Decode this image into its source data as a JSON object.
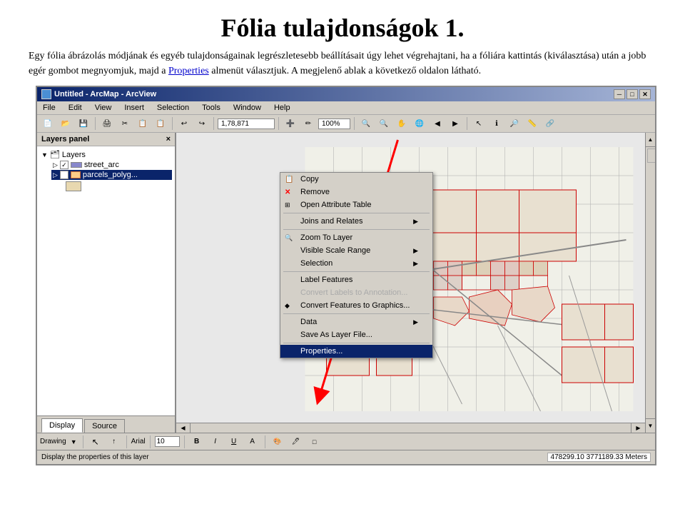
{
  "page": {
    "title": "Fólia tulajdonságok 1.",
    "description_part1": "Egy fólia ábrázolás módjának és egyéb tulajdonságainak legrészletesebb beállításait úgy lehet végrehajtani, ha a fóliára kattintás (kiválasztása) után a jobb egér gombot megnyomjuk, majd a ",
    "description_link": "Properties",
    "description_part2": " almenüt választjuk. A megjelenő ablak a következő oldalon látható."
  },
  "window": {
    "title": "Untitled - ArcMap - ArcView",
    "minimize": "─",
    "maximize": "□",
    "close": "✕"
  },
  "menubar": {
    "items": [
      "File",
      "Edit",
      "View",
      "Insert",
      "Selection",
      "Tools",
      "Window",
      "Help"
    ]
  },
  "toolbar": {
    "coord_display": "1,78,871",
    "zoom_level": "100%",
    "font_name": "Arial",
    "font_size": "10"
  },
  "toc": {
    "header": "×",
    "layers_label": "Layers",
    "layer1": {
      "name": "street_arc",
      "checked": true
    },
    "layer2": {
      "name": "parcels_polyg...",
      "checked": true,
      "selected": true
    }
  },
  "context_menu": {
    "items": [
      {
        "id": "copy",
        "label": "Copy",
        "icon": "📋",
        "has_arrow": false,
        "disabled": false
      },
      {
        "id": "remove",
        "label": "Remove",
        "icon": "✕",
        "has_arrow": false,
        "disabled": false
      },
      {
        "id": "open-attr-table",
        "label": "Open Attribute Table",
        "icon": "🗂",
        "has_arrow": false,
        "disabled": false
      },
      {
        "id": "joins-relates",
        "label": "Joins and Relates",
        "icon": "",
        "has_arrow": true,
        "disabled": false
      },
      {
        "id": "zoom-to-layer",
        "label": "Zoom To Layer",
        "icon": "🔍",
        "has_arrow": false,
        "disabled": false
      },
      {
        "id": "visible-scale",
        "label": "Visible Scale Range",
        "icon": "",
        "has_arrow": true,
        "disabled": false
      },
      {
        "id": "selection",
        "label": "Selection",
        "icon": "",
        "has_arrow": true,
        "disabled": false
      },
      {
        "id": "label-features",
        "label": "Label Features",
        "icon": "",
        "has_arrow": false,
        "disabled": false
      },
      {
        "id": "convert-labels-annotation",
        "label": "Convert Labels to Annotation...",
        "icon": "",
        "has_arrow": false,
        "disabled": true
      },
      {
        "id": "convert-features-graphics",
        "label": "Convert Features to Graphics...",
        "icon": "",
        "has_arrow": false,
        "disabled": false
      },
      {
        "id": "data",
        "label": "Data",
        "icon": "",
        "has_arrow": true,
        "disabled": false
      },
      {
        "id": "save-layer-file",
        "label": "Save As Layer File...",
        "icon": "",
        "has_arrow": false,
        "disabled": false
      },
      {
        "id": "properties",
        "label": "Properties...",
        "icon": "",
        "has_arrow": false,
        "disabled": false,
        "highlighted": true
      }
    ]
  },
  "bottom_tabs": {
    "tab1": "Display",
    "tab2": "Source"
  },
  "status_bar": {
    "message": "Display the properties of this layer",
    "coords": "478299.10  3771189.33 Meters"
  },
  "drawing_toolbar": {
    "label": "Drawing",
    "font_name": "Arial",
    "font_size": "10"
  }
}
